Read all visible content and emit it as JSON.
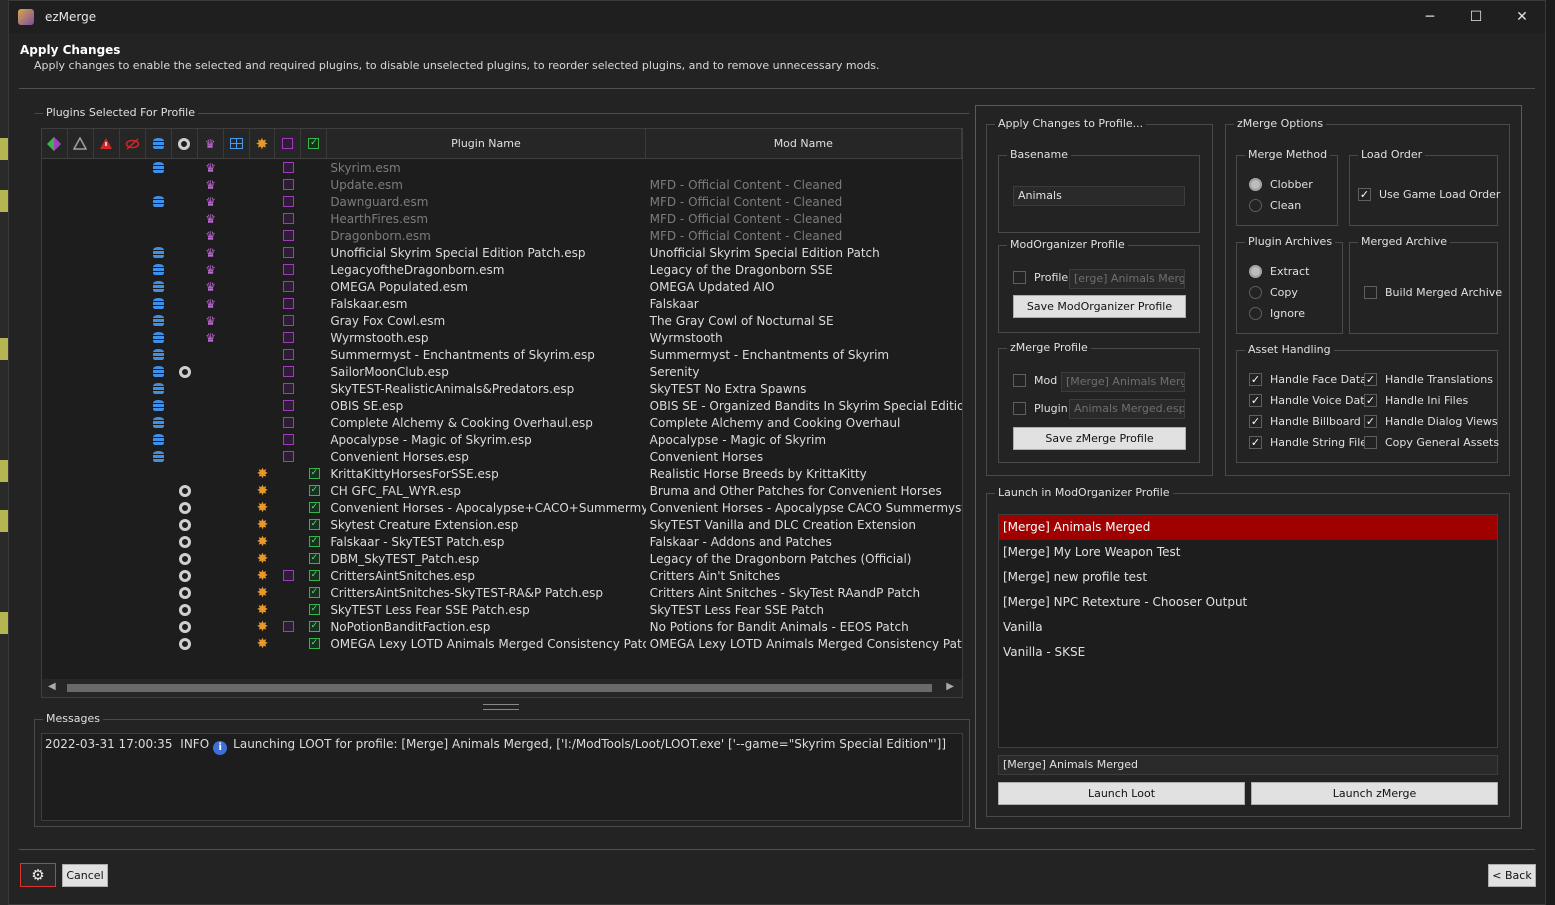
{
  "window": {
    "title": "ezMerge",
    "min": "─",
    "max": "☐",
    "close": "✕"
  },
  "header": {
    "title": "Apply Changes",
    "subtitle": "Apply changes to enable the selected and required plugins, to disable unselected plugins, to reorder selected plugins, and to remove unnecessary mods."
  },
  "plugins": {
    "group_label": "Plugins Selected For Profile",
    "col_plugin": "Plugin Name",
    "col_mod": "Mod Name",
    "rows": [
      {
        "p": "Skyrim.esm",
        "m": "",
        "db": 1,
        "ring": 0,
        "crown": 1,
        "gear": 0,
        "pc": 1,
        "gc": 0,
        "dim": 1
      },
      {
        "p": "Update.esm",
        "m": "MFD - Official Content - Cleaned",
        "db": 0,
        "ring": 0,
        "crown": 1,
        "gear": 0,
        "pc": 1,
        "gc": 0,
        "dim": 1
      },
      {
        "p": "Dawnguard.esm",
        "m": "MFD - Official Content - Cleaned",
        "db": 1,
        "ring": 0,
        "crown": 1,
        "gear": 0,
        "pc": 1,
        "gc": 0,
        "dim": 1
      },
      {
        "p": "HearthFires.esm",
        "m": "MFD - Official Content - Cleaned",
        "db": 0,
        "ring": 0,
        "crown": 1,
        "gear": 0,
        "pc": 1,
        "gc": 0,
        "dim": 1
      },
      {
        "p": "Dragonborn.esm",
        "m": "MFD - Official Content - Cleaned",
        "db": 0,
        "ring": 0,
        "crown": 1,
        "gear": 0,
        "pc": 1,
        "gc": 0,
        "dim": 1
      },
      {
        "p": "Unofficial Skyrim Special Edition Patch.esp",
        "m": "Unofficial Skyrim Special Edition Patch",
        "db": 1,
        "ring": 0,
        "crown": 1,
        "gear": 0,
        "pc": 1,
        "gc": 0,
        "dim": 0
      },
      {
        "p": "LegacyoftheDragonborn.esm",
        "m": "Legacy of the Dragonborn SSE",
        "db": 1,
        "ring": 0,
        "crown": 1,
        "gear": 0,
        "pc": 1,
        "gc": 0,
        "dim": 0
      },
      {
        "p": "OMEGA Populated.esm",
        "m": "OMEGA Updated AIO",
        "db": 1,
        "ring": 0,
        "crown": 1,
        "gear": 0,
        "pc": 1,
        "gc": 0,
        "dim": 0
      },
      {
        "p": "Falskaar.esm",
        "m": "Falskaar",
        "db": 1,
        "ring": 0,
        "crown": 1,
        "gear": 0,
        "pc": 1,
        "gc": 0,
        "dim": 0
      },
      {
        "p": "Gray Fox Cowl.esm",
        "m": "The Gray Cowl of Nocturnal SE",
        "db": 1,
        "ring": 0,
        "crown": 1,
        "gear": 0,
        "pc": 1,
        "gc": 0,
        "dim": 0
      },
      {
        "p": "Wyrmstooth.esp",
        "m": "Wyrmstooth",
        "db": 1,
        "ring": 0,
        "crown": 1,
        "gear": 0,
        "pc": 1,
        "gc": 0,
        "dim": 0
      },
      {
        "p": "Summermyst - Enchantments of Skyrim.esp",
        "m": "Summermyst - Enchantments of Skyrim",
        "db": 1,
        "ring": 0,
        "crown": 0,
        "gear": 0,
        "pc": 1,
        "gc": 0,
        "dim": 0
      },
      {
        "p": "SailorMoonClub.esp",
        "m": "Serenity",
        "db": 1,
        "ring": 1,
        "crown": 0,
        "gear": 0,
        "pc": 1,
        "gc": 0,
        "dim": 0
      },
      {
        "p": "SkyTEST-RealisticAnimals&Predators.esp",
        "m": "SkyTEST No Extra Spawns",
        "db": 1,
        "ring": 0,
        "crown": 0,
        "gear": 0,
        "pc": 1,
        "gc": 0,
        "dim": 0
      },
      {
        "p": "OBIS SE.esp",
        "m": "OBIS SE - Organized Bandits In Skyrim Special Edition",
        "db": 1,
        "ring": 0,
        "crown": 0,
        "gear": 0,
        "pc": 1,
        "gc": 0,
        "dim": 0
      },
      {
        "p": "Complete Alchemy & Cooking Overhaul.esp",
        "m": "Complete Alchemy and Cooking Overhaul",
        "db": 1,
        "ring": 0,
        "crown": 0,
        "gear": 0,
        "pc": 1,
        "gc": 0,
        "dim": 0
      },
      {
        "p": "Apocalypse - Magic of Skyrim.esp",
        "m": "Apocalypse - Magic of Skyrim",
        "db": 1,
        "ring": 0,
        "crown": 0,
        "gear": 0,
        "pc": 1,
        "gc": 0,
        "dim": 0
      },
      {
        "p": "Convenient Horses.esp",
        "m": "Convenient Horses",
        "db": 1,
        "ring": 0,
        "crown": 0,
        "gear": 0,
        "pc": 1,
        "gc": 0,
        "dim": 0
      },
      {
        "p": "KrittaKittyHorsesForSSE.esp",
        "m": "Realistic Horse Breeds by KrittaKitty",
        "db": 0,
        "ring": 0,
        "crown": 0,
        "gear": 1,
        "pc": 0,
        "gc": 1,
        "dim": 0
      },
      {
        "p": "CH GFC_FAL_WYR.esp",
        "m": "Bruma and Other Patches for Convenient Horses",
        "db": 0,
        "ring": 1,
        "crown": 0,
        "gear": 1,
        "pc": 0,
        "gc": 1,
        "dim": 0
      },
      {
        "p": "Convenient Horses - Apocalypse+CACO+Summermyst.esp",
        "m": "Convenient Horses - Apocalypse CACO Summermyst Patch",
        "db": 0,
        "ring": 1,
        "crown": 0,
        "gear": 1,
        "pc": 0,
        "gc": 1,
        "dim": 0
      },
      {
        "p": "Skytest Creature Extension.esp",
        "m": "SkyTEST Vanilla and DLC Creation Extension",
        "db": 0,
        "ring": 1,
        "crown": 0,
        "gear": 1,
        "pc": 0,
        "gc": 1,
        "dim": 0
      },
      {
        "p": "Falskaar - SkyTEST Patch.esp",
        "m": "Falskaar - Addons and Patches",
        "db": 0,
        "ring": 1,
        "crown": 0,
        "gear": 1,
        "pc": 0,
        "gc": 1,
        "dim": 0
      },
      {
        "p": "DBM_SkyTEST_Patch.esp",
        "m": "Legacy of the Dragonborn Patches (Official)",
        "db": 0,
        "ring": 1,
        "crown": 0,
        "gear": 1,
        "pc": 0,
        "gc": 1,
        "dim": 0
      },
      {
        "p": "CrittersAintSnitches.esp",
        "m": "Critters Ain't Snitches",
        "db": 0,
        "ring": 1,
        "crown": 0,
        "gear": 1,
        "pc": 1,
        "gc": 1,
        "dim": 0
      },
      {
        "p": "CrittersAintSnitches-SkyTEST-RA&P Patch.esp",
        "m": "Critters Aint Snitches - SkyTest RAandP Patch",
        "db": 0,
        "ring": 1,
        "crown": 0,
        "gear": 1,
        "pc": 0,
        "gc": 1,
        "dim": 0
      },
      {
        "p": "SkyTEST Less Fear SSE Patch.esp",
        "m": "SkyTEST Less Fear SSE Patch",
        "db": 0,
        "ring": 1,
        "crown": 0,
        "gear": 1,
        "pc": 0,
        "gc": 1,
        "dim": 0
      },
      {
        "p": "NoPotionBanditFaction.esp",
        "m": "No Potions for Bandit Animals - EEOS Patch",
        "db": 0,
        "ring": 1,
        "crown": 0,
        "gear": 1,
        "pc": 1,
        "gc": 1,
        "dim": 0
      },
      {
        "p": "OMEGA Lexy LOTD Animals Merged Consistency Patch.esp",
        "m": "OMEGA Lexy LOTD Animals Merged Consistency Patch",
        "db": 0,
        "ring": 1,
        "crown": 0,
        "gear": 1,
        "pc": 0,
        "gc": 1,
        "dim": 0
      }
    ]
  },
  "messages": {
    "label": "Messages",
    "timestamp": "2022-03-31 17:00:35",
    "level": "INFO",
    "text": "Launching LOOT for profile: [Merge] Animals Merged, ['I:/ModTools/Loot/LOOT.exe' ['--game=\"Skyrim Special Edition\"']]"
  },
  "apply": {
    "label": "Apply Changes to Profile...",
    "basename_label": "Basename",
    "basename_value": "Animals",
    "mo_label": "ModOrganizer Profile",
    "mo_profile_check": "Profile",
    "mo_profile_placeholder": "[erge] Animals Merged",
    "mo_save": "Save ModOrganizer Profile",
    "zm_label": "zMerge Profile",
    "zm_mod_check": "Mod",
    "zm_mod_placeholder": "[Merge] Animals Merged",
    "zm_plugin_check": "Plugin",
    "zm_plugin_placeholder": "Animals Merged.esp",
    "zm_save": "Save zMerge Profile"
  },
  "options": {
    "label": "zMerge Options",
    "merge_method": {
      "label": "Merge Method",
      "clobber": "Clobber",
      "clean": "Clean"
    },
    "load_order": {
      "label": "Load Order",
      "use_game": "Use Game Load Order"
    },
    "plugin_archives": {
      "label": "Plugin Archives",
      "extract": "Extract",
      "copy": "Copy",
      "ignore": "Ignore"
    },
    "merged_archive": {
      "label": "Merged Archive",
      "build": "Build Merged Archive"
    },
    "asset_handling": {
      "label": "Asset Handling",
      "face": "Handle Face Data",
      "translations": "Handle Translations",
      "voice": "Handle Voice Data",
      "ini": "Handle Ini Files",
      "billboard": "Handle Billboard",
      "dialog": "Handle Dialog Views",
      "string": "Handle String Files",
      "general": "Copy General Assets"
    }
  },
  "launch": {
    "label": "Launch in ModOrganizer Profile",
    "items": [
      "[Merge] Animals Merged",
      "[Merge] My Lore Weapon Test",
      "[Merge] new profile test",
      "[Merge] NPC Retexture - Chooser Output",
      "Vanilla",
      "Vanilla - SKSE"
    ],
    "selected_value": "[Merge] Animals Merged",
    "launch_loot": "Launch Loot",
    "launch_zmerge": "Launch zMerge"
  },
  "footer": {
    "cancel": "Cancel",
    "back": "< Back",
    "settings_icon": "gear-icon"
  }
}
